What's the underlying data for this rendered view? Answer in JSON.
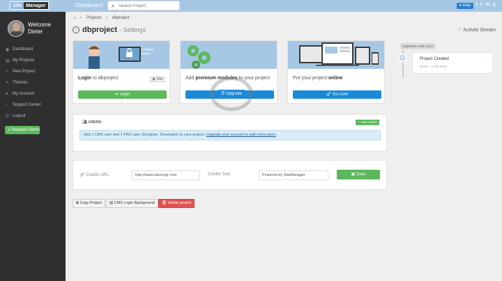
{
  "topbar": {
    "logo_part1": "Site",
    "logo_part2": "Manager",
    "dashboard_label": "Dashboard",
    "search_placeholder": "Search Project",
    "help_label": "Help",
    "social": [
      "f",
      "t",
      "in",
      "g"
    ]
  },
  "sidebar": {
    "welcome": "Welcome",
    "user_name": "Dieter",
    "items": [
      {
        "icon": "dashboard-icon",
        "label": "Dashboard"
      },
      {
        "icon": "folder-icon",
        "label": "My Projects"
      },
      {
        "icon": "plus-icon",
        "label": "New Project"
      },
      {
        "icon": "brush-icon",
        "label": "Themes"
      },
      {
        "icon": "user-icon",
        "label": "My Account"
      },
      {
        "icon": "support-icon",
        "label": "Support Center"
      },
      {
        "icon": "power-icon",
        "label": "Logout"
      }
    ],
    "request_demo": "Request Demo"
  },
  "breadcrumb": {
    "home_icon": "home-icon",
    "items": [
      "Projects",
      "dbproject"
    ]
  },
  "page": {
    "title": "dbproject",
    "subtitle": "- Settings"
  },
  "cards": [
    {
      "text_pre": "",
      "text_bold": "Login",
      "text_post": " to dbproject",
      "visit_label": "Visit",
      "button_label": "Login"
    },
    {
      "text_pre": "Add ",
      "text_bold": "premium modules",
      "text_post": " to your project",
      "button_label": "Upgrade"
    },
    {
      "text_pre": "Put your project ",
      "text_bold": "online",
      "text_post": "",
      "button_label": "Go Live!"
    }
  ],
  "users": {
    "heading": "USERS",
    "add_label": "ADD USER",
    "info_text": "Add 1 CMS user and 1 PRO user (Designer, Developer) to your project. ",
    "info_link": "Upgrade your account to add more users"
  },
  "credits": {
    "url_label": "Credits URL:",
    "url_value": "http://www.sitemngr.com",
    "text_label": "Credits Text:",
    "text_value": "Powered by SiteManager",
    "save_label": "Save"
  },
  "actions": {
    "copy": "Copy Project",
    "cms_bg": "CMS Login Background",
    "delete": "Delete project"
  },
  "activity": {
    "title": "Activity Stream",
    "date": "September 20th, 2017",
    "event_title": "Project Created",
    "event_user": "Dieter",
    "event_time": "08:40:54"
  },
  "colors": {
    "topbar": "#a7c8e4",
    "sidebar": "#2f2f2f",
    "green": "#5cb85c",
    "blue": "#1a8ad8",
    "red": "#e05252"
  }
}
